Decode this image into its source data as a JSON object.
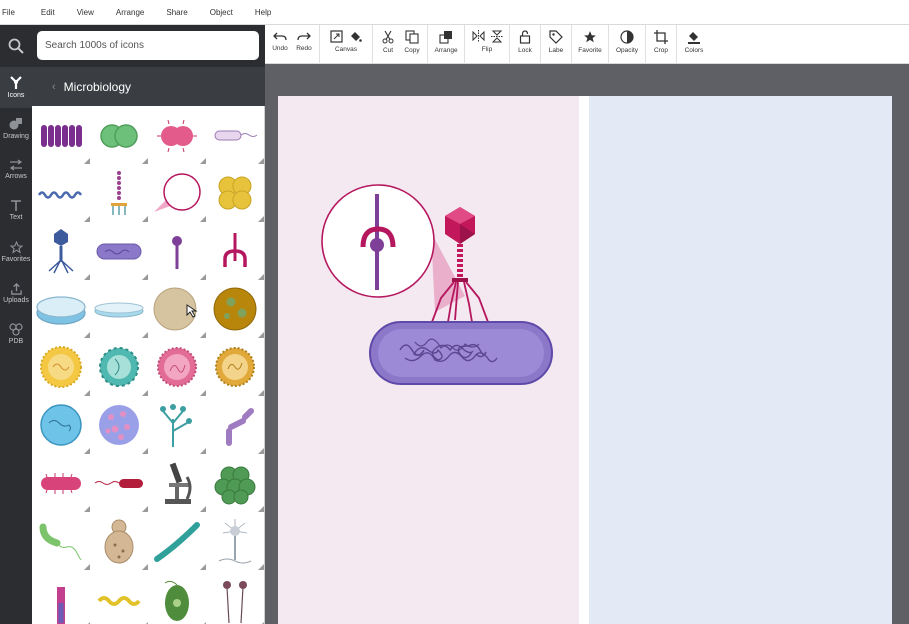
{
  "menu": [
    "File",
    "Edit",
    "View",
    "Arrange",
    "Share",
    "Object",
    "Help"
  ],
  "rail": {
    "items": [
      {
        "label": "Icons",
        "icon": "icons-icon"
      },
      {
        "label": "Drawing",
        "icon": "drawing-icon"
      },
      {
        "label": "Arrows",
        "icon": "arrows-icon"
      },
      {
        "label": "Text",
        "icon": "text-icon"
      },
      {
        "label": "Favorites",
        "icon": "star-icon"
      },
      {
        "label": "Uploads",
        "icon": "upload-icon"
      },
      {
        "label": "PDB",
        "icon": "pdb-icon"
      }
    ]
  },
  "panel": {
    "search_placeholder": "Search 1000s of icons",
    "category_title": "Microbiology"
  },
  "toolbar": {
    "undo": "Undo",
    "redo": "Redo",
    "canvas": "Canvas",
    "cut": "Cut",
    "copy": "Copy",
    "arrange": "Arrange",
    "flip": "Flip",
    "lock": "Lock",
    "label": "Labe",
    "favorite": "Favorite",
    "opacity": "Opacity",
    "crop": "Crop",
    "colors": "Colors"
  },
  "colors": {
    "accent_magenta": "#b5175e",
    "purple": "#7e3f98",
    "bacterium_purple": "#8b78c9",
    "page_pink": "#f4e9f1",
    "page_blue": "#e4eaf5",
    "dark_chrome": "#2b2d31"
  }
}
